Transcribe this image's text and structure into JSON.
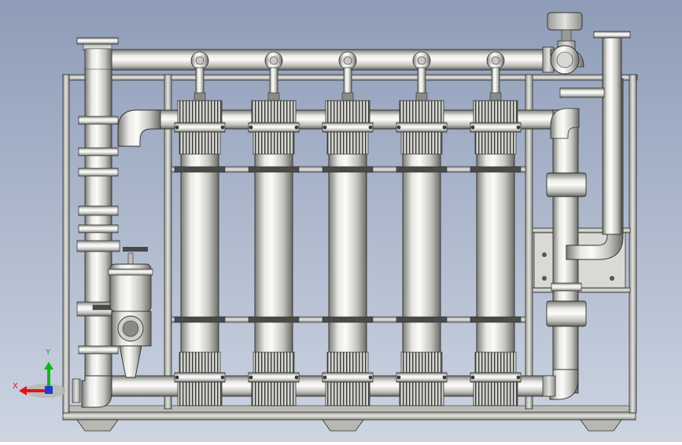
{
  "scene": {
    "background": {
      "top": "#8e9cb8",
      "bottom": "#cdd5e2"
    },
    "metal": {
      "light": "#f4f4f2",
      "mid": "#c9c9c5",
      "dark": "#6e6e6a",
      "edge": "#2f2f2d"
    },
    "membrane_modules": 5,
    "valve_tee_count": 5
  },
  "triad": {
    "x_label": "X",
    "y_label": "Y",
    "x_color": "#e0141e",
    "y_color": "#12b41e",
    "z_color": "#1e3cd2"
  }
}
